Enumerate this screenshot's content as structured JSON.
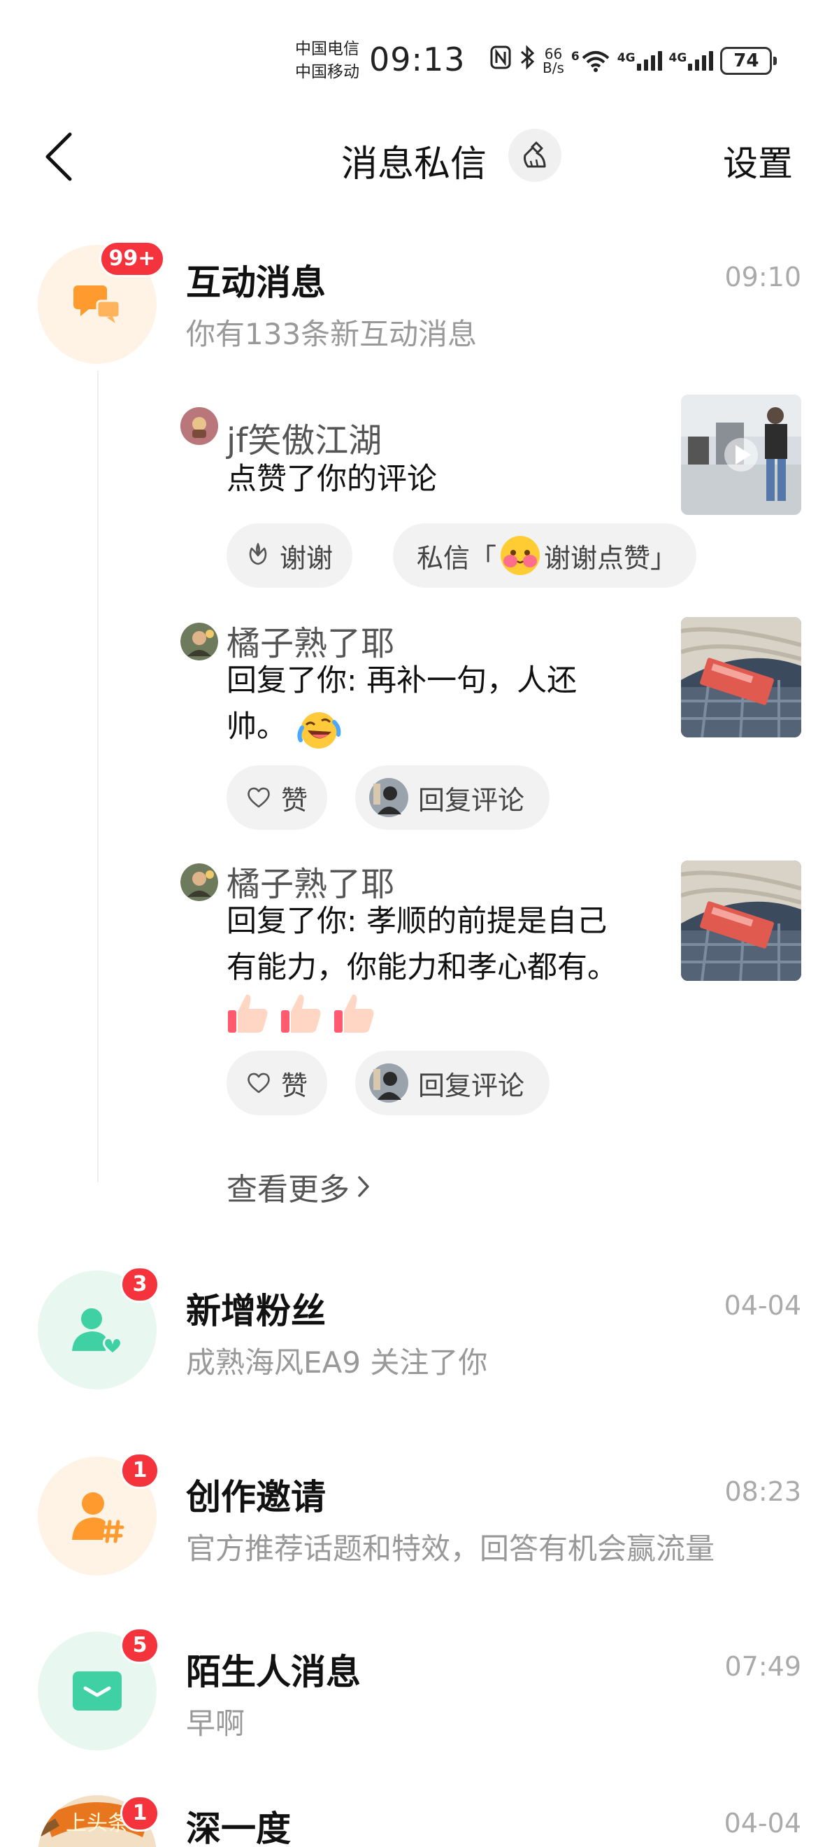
{
  "status_bar": {
    "carrier_1": "中国电信",
    "carrier_2": "中国移动",
    "time": "09:13",
    "speed_value": "66",
    "speed_unit": "B/s",
    "net_1": "4G",
    "net_2": "4G",
    "battery": "74",
    "wifi_tag": "6"
  },
  "header": {
    "title": "消息私信",
    "settings_label": "设置"
  },
  "interaction": {
    "title": "互动消息",
    "subtitle": "你有133条新互动消息",
    "time": "09:10",
    "badge": "99+",
    "items": [
      {
        "name": "jf笑傲江湖",
        "text": "点赞了你的评论",
        "action_1": "谢谢",
        "action_2_prefix": "私信「",
        "action_2_text": "谢谢点赞」"
      },
      {
        "name": "橘子熟了耶",
        "text_line1": "回复了你: 再补一句，人还",
        "text_line2": "帅。",
        "like_label": "赞",
        "reply_label": "回复评论"
      },
      {
        "name": "橘子熟了耶",
        "text_line1": "回复了你: 孝顺的前提是自己",
        "text_line2": "有能力，你能力和孝心都有。",
        "like_label": "赞",
        "reply_label": "回复评论"
      }
    ],
    "see_more": "查看更多"
  },
  "new_fans": {
    "title": "新增粉丝",
    "subtitle": "成熟海风EA9 关注了你",
    "time": "04-04",
    "badge": "3"
  },
  "creation_invite": {
    "title": "创作邀请",
    "subtitle": "官方推荐话题和特效，回答有机会赢流量",
    "time": "08:23",
    "badge": "1"
  },
  "stranger": {
    "title": "陌生人消息",
    "subtitle": "早啊",
    "time": "07:49",
    "badge": "5"
  },
  "partial_row": {
    "title": "深一度",
    "time": "04-04",
    "badge": "1",
    "avatar_text": "上头条"
  },
  "colors": {
    "badge_red": "#f4333c",
    "orange": "#ff9a2e",
    "green": "#3fd1a3",
    "orange_bg": "#fff3e6",
    "green_bg": "#e8f8f1"
  }
}
